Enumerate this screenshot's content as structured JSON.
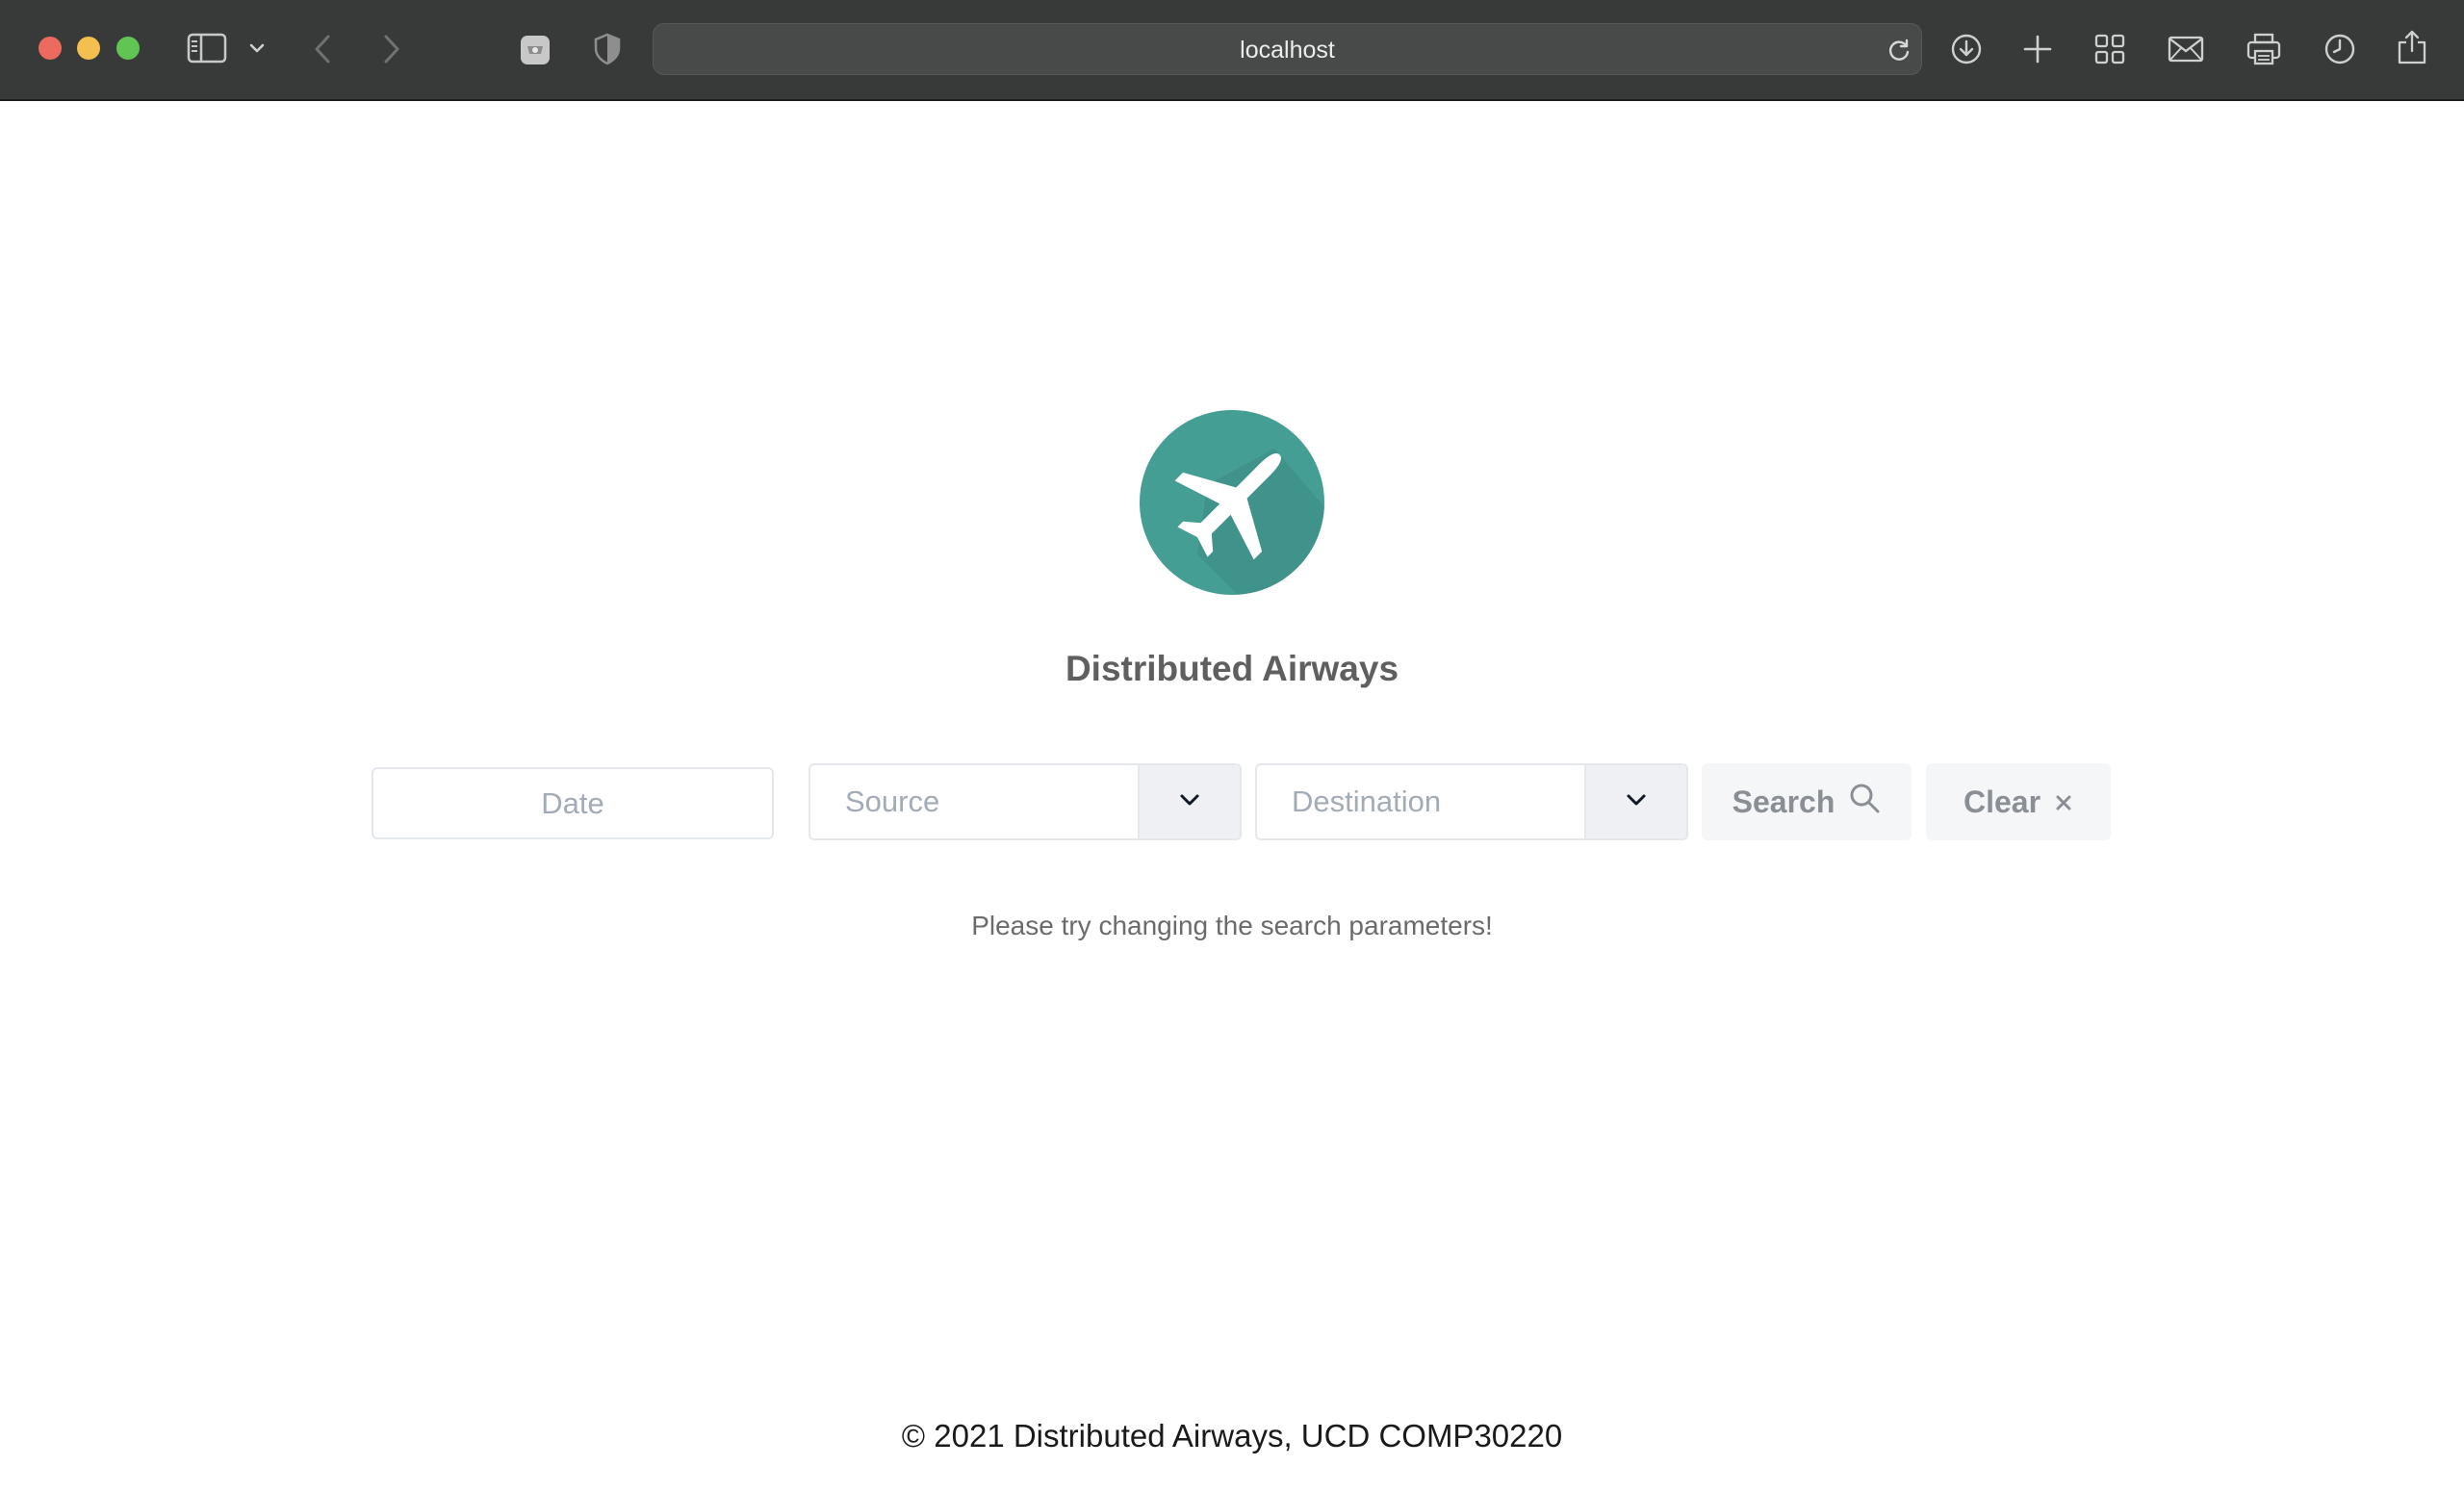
{
  "browser": {
    "address": "localhost"
  },
  "brand": {
    "title": "Distributed Airways",
    "logo_icon": "airplane-icon",
    "logo_color": "#459e94"
  },
  "search": {
    "date_placeholder": "Date",
    "source_placeholder": "Source",
    "destination_placeholder": "Destination",
    "search_label": "Search",
    "clear_label": "Clear"
  },
  "message": "Please try changing the search parameters!",
  "footer": "© 2021 Distributed Airways, UCD COMP30220"
}
